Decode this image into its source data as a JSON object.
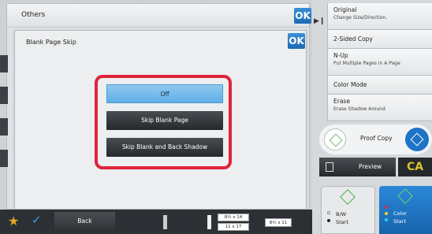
{
  "others": {
    "title": "Others",
    "ok_label": "OK"
  },
  "dialog": {
    "title": "Blank Page Skip",
    "ok_label": "OK",
    "options": [
      {
        "label": "Off",
        "selected": true
      },
      {
        "label": "Skip Blank Page",
        "selected": false
      },
      {
        "label": "Skip Blank and Back Shadow",
        "selected": false
      }
    ]
  },
  "menu": {
    "original": {
      "label": "Original",
      "sub": "Change Size/Direction."
    },
    "two_sided": {
      "label": "2-Sided Copy"
    },
    "nup": {
      "label": "N-Up",
      "sub": "Put Multiple Pages in A Page"
    },
    "color_mode": {
      "label": "Color Mode"
    },
    "erase": {
      "label": "Erase",
      "sub": "Erase Shadow Around"
    }
  },
  "proof_copy": {
    "label": "Proof Copy"
  },
  "preview": {
    "label": "Preview"
  },
  "ca": {
    "label": "CA"
  },
  "bw_start": {
    "line1": "B/W",
    "line2": "Start"
  },
  "color_start": {
    "line1": "Color",
    "line2": "Start"
  },
  "bottom": {
    "back_label": "Back",
    "paper_1": "8½ x 14",
    "paper_2": "11 x 17",
    "paper_3": "8½ x 11"
  },
  "colors": {
    "highlight": "#e0243c",
    "accent": "#1f74c8",
    "ca": "#d8c22b"
  }
}
